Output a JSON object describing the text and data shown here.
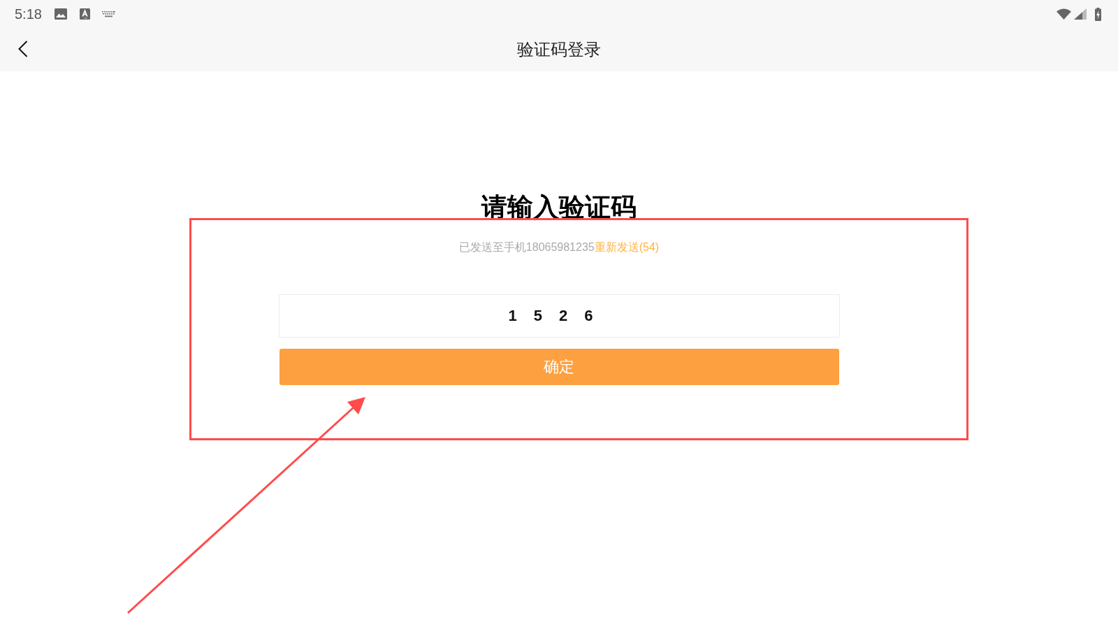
{
  "status_bar": {
    "time": "5:18"
  },
  "header": {
    "title": "验证码登录"
  },
  "heading": "请输入验证码",
  "sent_notice": {
    "text": "已发送至手机18065981235",
    "resend_link": "重新发送(54)"
  },
  "code_field": {
    "value": "1526"
  },
  "confirm_button": {
    "label": "确定"
  }
}
